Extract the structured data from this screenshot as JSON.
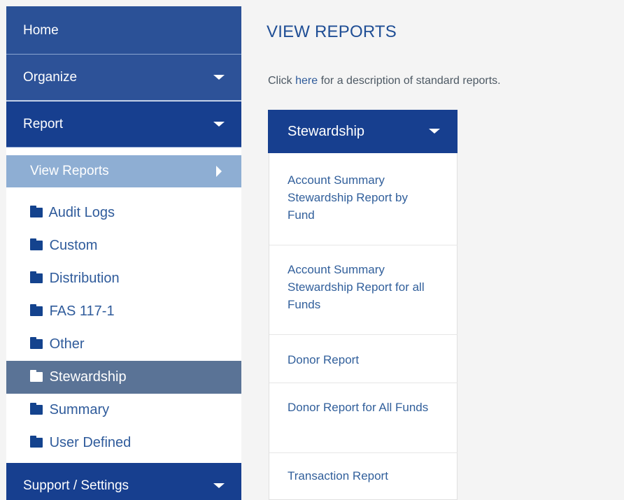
{
  "sidebar": {
    "home": "Home",
    "organize": "Organize",
    "report": "Report",
    "view_reports": "View Reports",
    "folders": [
      "Audit Logs",
      "Custom",
      "Distribution",
      "FAS 117-1",
      "Other",
      "Stewardship",
      "Summary",
      "User Defined"
    ],
    "selected_folder": "Stewardship",
    "support_settings": "Support / Settings"
  },
  "main": {
    "title": "VIEW REPORTS",
    "description_prefix": "Click ",
    "description_link": "here",
    "description_suffix": " for a description of standard reports.",
    "category_dropdown": "Stewardship",
    "reports": [
      "Account Summary Stewardship Report by Fund",
      "Account Summary Stewardship Report for all Funds",
      "Donor Report",
      "Donor Report for All Funds",
      "Transaction Report"
    ]
  },
  "colors": {
    "nav_dark": "#173f8f",
    "nav_light": "#8eaed3",
    "selected_folder_bg": "#5a7396",
    "link_blue": "#2f5b9b"
  },
  "icons": {
    "folder": "folder-icon",
    "caret_down": "chevron-down-icon",
    "caret_right": "chevron-right-icon"
  }
}
